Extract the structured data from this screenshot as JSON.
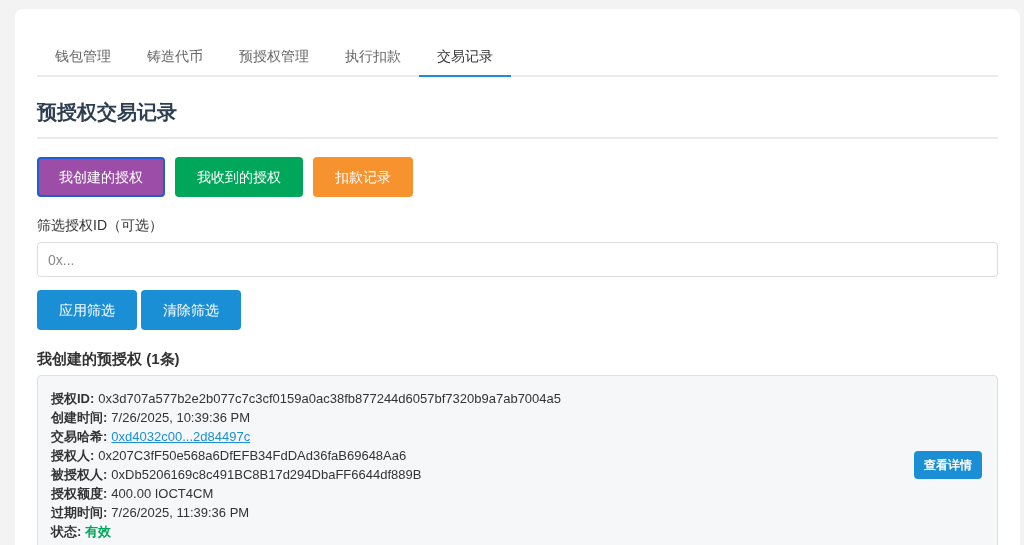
{
  "tabs": [
    {
      "label": "钱包管理",
      "selected": false
    },
    {
      "label": "铸造代币",
      "selected": false
    },
    {
      "label": "预授权管理",
      "selected": false
    },
    {
      "label": "执行扣款",
      "selected": false
    },
    {
      "label": "交易记录",
      "selected": true
    }
  ],
  "heading": "预授权交易记录",
  "record_types": [
    {
      "label": "我创建的授权",
      "color": "#9b4da8",
      "selected": true
    },
    {
      "label": "我收到的授权",
      "color": "#00a65a",
      "selected": false
    },
    {
      "label": "扣款记录",
      "color": "#f7932f",
      "selected": false
    }
  ],
  "filter": {
    "label": "筛选授权ID（可选）",
    "placeholder": "0x...",
    "buttons": [
      "应用筛选",
      "清除筛选"
    ]
  },
  "results": {
    "title": "我创建的预授权 (1条)",
    "records": [
      {
        "fields": [
          {
            "kind": "text",
            "label": "授权ID:",
            "value": "0x3d707a577b2e2b077c7c3cf0159a0ac38fb877244d6057bf7320b9a7ab7004a5"
          },
          {
            "kind": "text",
            "label": "创建时间:",
            "value": "7/26/2025, 10:39:36 PM"
          },
          {
            "kind": "link",
            "label": "交易哈希:",
            "value": "0xd4032c00...2d84497c"
          },
          {
            "kind": "text",
            "label": "授权人:",
            "value": "0x207C3fF50e568a6DfEFB34FdDAd36faB69648Aa6"
          },
          {
            "kind": "text",
            "label": "被授权人:",
            "value": "0xDb5206169c8c491BC8B17d294DbaFF6644df889B"
          },
          {
            "kind": "text",
            "label": "授权额度:",
            "value": "400.00 IOCT4CM"
          },
          {
            "kind": "text",
            "label": "过期时间:",
            "value": "7/26/2025, 11:39:36 PM"
          },
          {
            "kind": "status",
            "label": "状态:",
            "value": "有效",
            "color": "#00a65a"
          }
        ],
        "action": "查看详情"
      }
    ]
  }
}
